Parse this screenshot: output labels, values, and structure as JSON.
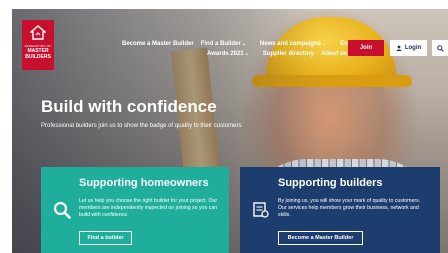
{
  "logo": {
    "small_text": "FEDERATION OF",
    "line1": "MASTER",
    "line2": "BUILDERS"
  },
  "nav": {
    "row1": [
      {
        "label": "Become a Master Builder",
        "dropdown": false
      },
      {
        "label": "Find a Builder",
        "dropdown": true
      },
      {
        "label": "News and campaigns",
        "dropdown": true
      },
      {
        "label": "Events",
        "dropdown": false
      }
    ],
    "row2": [
      {
        "label": "Awards 2021",
        "dropdown": true
      },
      {
        "label": "Supplier directory",
        "dropdown": false
      },
      {
        "label": "About us",
        "dropdown": false
      }
    ],
    "join_label": "Join",
    "login_label": "Login",
    "search_icon": "search-icon"
  },
  "hero": {
    "title": "Build with confidence",
    "subtitle": "Professional builders join us to show the badge of quality to their customers"
  },
  "cards": {
    "homeowners": {
      "title": "Supporting homeowners",
      "text": "Let us help you choose the right builder for your project. Our members are independently inspected on joining so you can build with confidence.",
      "button": "Find a builder",
      "icon": "magnifier-icon"
    },
    "builders": {
      "title": "Supporting builders",
      "text": "By joining us, you will show your mark of quality to customers. Our services help members grow their business, network and skills.",
      "button": "Become a Master Builder",
      "icon": "certificate-icon"
    }
  },
  "colors": {
    "brand_red": "#c8102e",
    "teal": "#1fae9c",
    "navy": "#1c3d6e"
  }
}
